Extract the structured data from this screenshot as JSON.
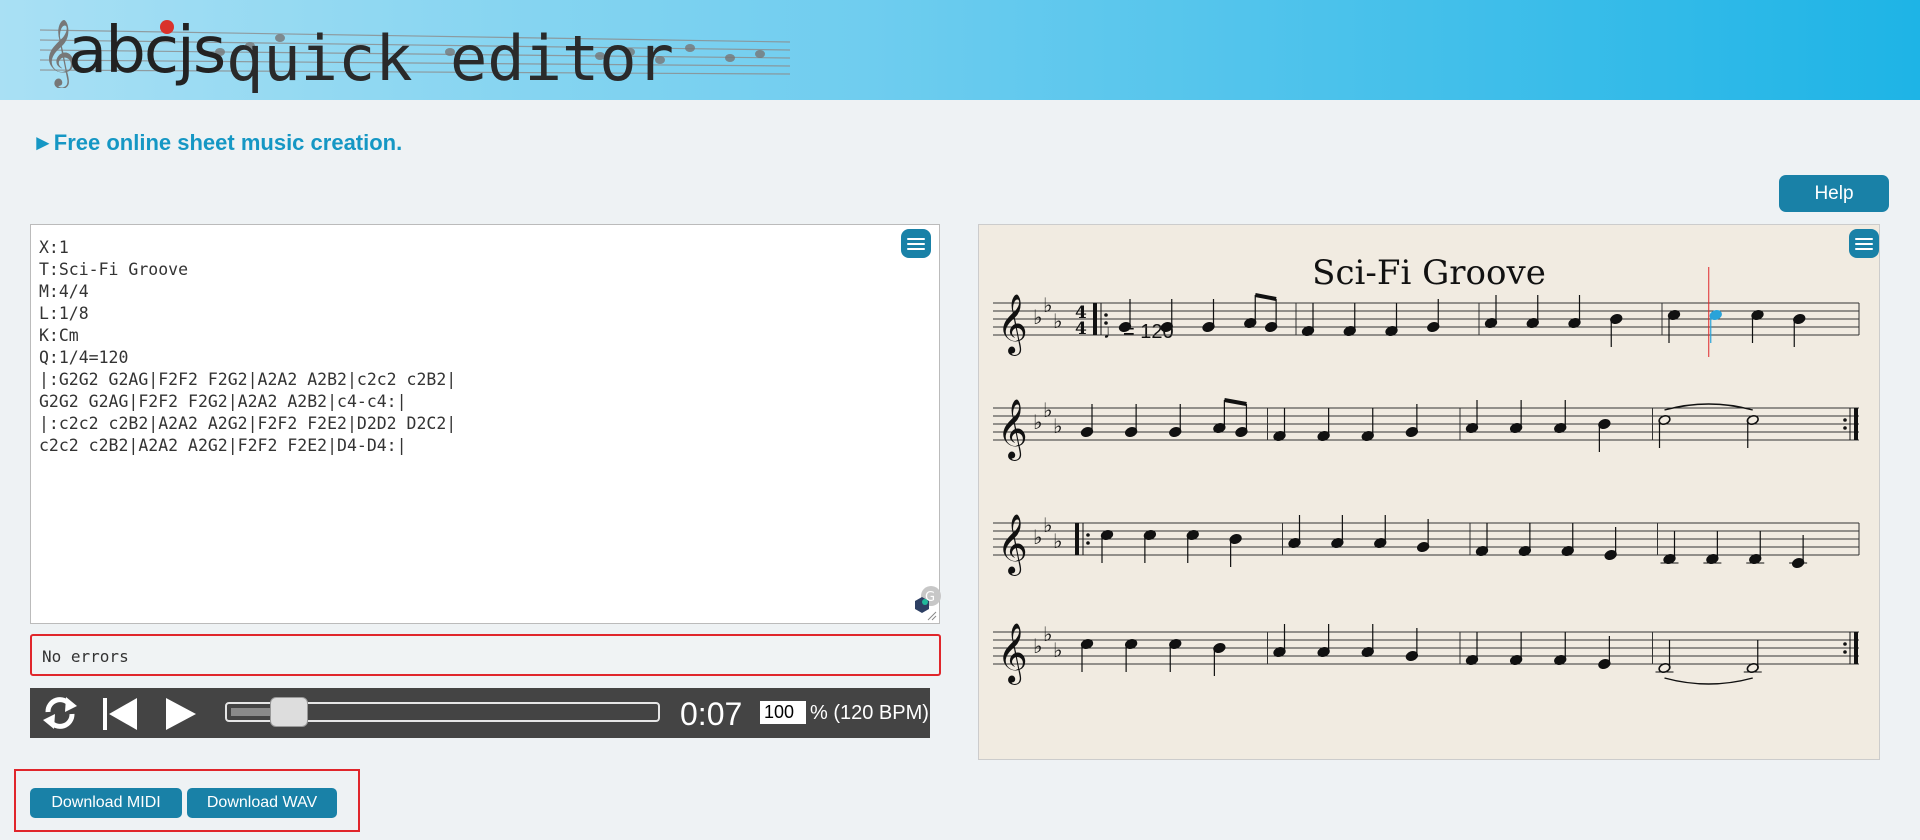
{
  "header": {
    "logo_abc": "abcjs",
    "logo_rest": "quick editor"
  },
  "tagline": {
    "arrow": "►",
    "text": "Free online sheet music creation."
  },
  "help_label": "Help",
  "editor": {
    "abc_text": "X:1\nT:Sci-Fi Groove\nM:4/4\nL:1/8\nK:Cm\nQ:1/4=120\n|:G2G2 G2AG|F2F2 F2G2|A2A2 A2B2|c2c2 c2B2|\nG2G2 G2AG|F2F2 F2G2|A2A2 A2B2|c4-c4:|\n|:c2c2 c2B2|A2A2 A2G2|F2F2 F2E2|D2D2 D2C2|\nc2c2 c2B2|A2A2 A2G2|F2F2 F2E2|D4-D4:|"
  },
  "status_text": "No errors",
  "player": {
    "time": "0:07",
    "tempo_percent": "100",
    "tempo_label": "% (120 BPM)",
    "progress_fraction": 0.13
  },
  "downloads": {
    "midi_label": "Download MIDI",
    "wav_label": "Download WAV"
  },
  "score": {
    "title": "Sci-Fi Groove",
    "tempo_text": "= 120",
    "key": "Cm",
    "meter": "4/4",
    "current_note_color": "#29a3d9"
  },
  "colors": {
    "accent": "#1981a7",
    "tagline": "#1597c4",
    "error_border": "#e0262b"
  }
}
